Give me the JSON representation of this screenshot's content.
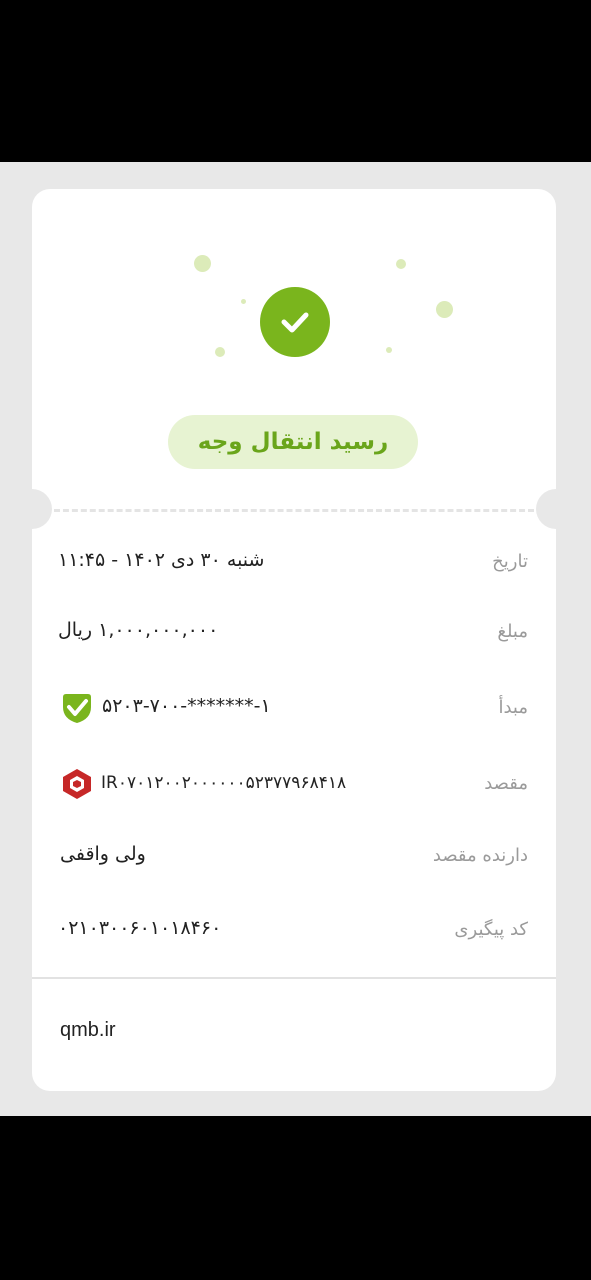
{
  "receipt": {
    "title": "رسید انتقال وجه",
    "rows": [
      {
        "label": "تاریخ",
        "value": "شنبه ۳۰  دی ۱۴۰۲  -  ۱۱:۴۵"
      },
      {
        "label": "مبلغ",
        "value": "۱,۰۰۰,۰۰۰,۰۰۰ ریال"
      },
      {
        "label": "مبدأ",
        "value": "۵۲۰۳-۷۰۰-*******-۱",
        "icon": "green-checkmark-bank-logo-icon"
      },
      {
        "label": "مقصد",
        "value": "IR۰۷۰۱۲۰۰۲۰۰۰۰۰۰۵۲۳۷۷۹۶۸۴۱۸",
        "icon": "red-bank-logo-icon"
      },
      {
        "label": "دارنده مقصد",
        "value": "ولی واقفی"
      },
      {
        "label": "کد پیگیری",
        "value": "۰۲۱۰۳۰۰۶۰۱۰۱۸۴۶۰"
      }
    ],
    "footer_url": "qmb.ir"
  },
  "colors": {
    "accent_green": "#7ab51d",
    "pill_background": "#e7f3d2",
    "page_background": "#e8e8e8",
    "bank_red": "#c62828"
  }
}
